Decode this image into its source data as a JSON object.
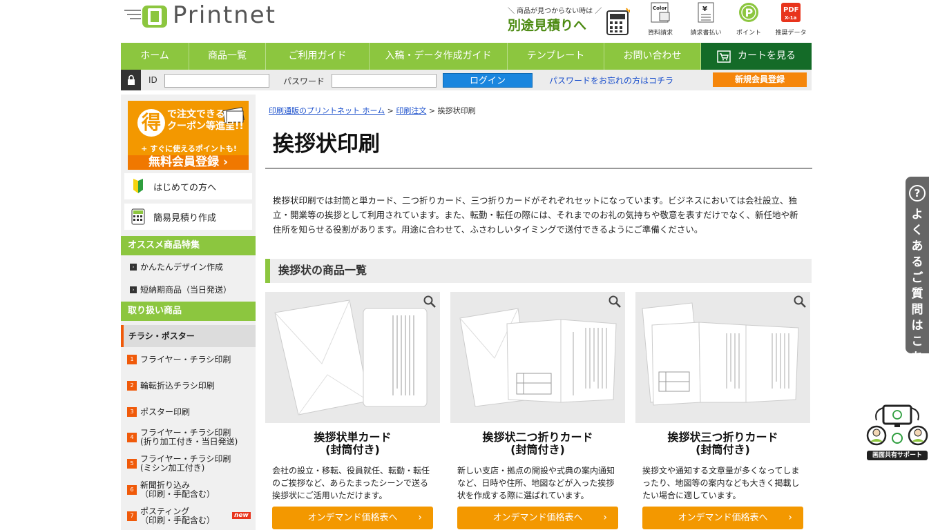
{
  "header": {
    "logo_text": "Printnet",
    "estimate_small": "＼ 商品が見つからない時は ／",
    "estimate_big": "別途見積りへ",
    "icons": [
      {
        "name": "catalog-icon",
        "label": "資料請求",
        "glyph": "Color"
      },
      {
        "name": "invoice-icon",
        "label": "請求書払い",
        "glyph": "¥"
      },
      {
        "name": "point-icon",
        "label": "ポイント",
        "glyph": "P"
      },
      {
        "name": "pdf-icon",
        "label": "推奨データ",
        "glyph": "PDF X-1a"
      }
    ]
  },
  "nav": {
    "items": [
      "ホーム",
      "商品一覧",
      "ご利用ガイド",
      "入稿・データ作成ガイド",
      "テンプレート",
      "お問い合わせ"
    ],
    "cart": "カートを見る"
  },
  "login": {
    "id_label": "ID",
    "password_label": "パスワード",
    "id_value": "",
    "password_value": "",
    "login_button": "ログイン",
    "forgot": "パスワードをお忘れの方はコチラ",
    "register": "新規会員登録"
  },
  "sidebar": {
    "banner": {
      "circle": "得",
      "line1": "で注文できる",
      "line2": "クーポン等進呈!!",
      "line3": "+ すぐに使えるポイントも!",
      "line4": "無料会員登録 ›"
    },
    "beginner": "はじめての方へ",
    "quick_estimate": "簡易見積り作成",
    "featured_header": "オススメ商品特集",
    "featured": [
      "かんたんデザイン作成",
      "短納期商品（当日発送）"
    ],
    "products_header": "取り扱い商品",
    "category": "チラシ・ポスター",
    "items": [
      {
        "num": "1",
        "line1": "フライヤー・チラシ印刷",
        "line2": ""
      },
      {
        "num": "2",
        "line1": "輪転折込チラシ印刷",
        "line2": ""
      },
      {
        "num": "3",
        "line1": "ポスター印刷",
        "line2": ""
      },
      {
        "num": "4",
        "line1": "フライヤー・チラシ印刷",
        "line2": "(折り加工付き・当日発送)"
      },
      {
        "num": "5",
        "line1": "フライヤー・チラシ印刷",
        "line2": "(ミシン加工付き)"
      },
      {
        "num": "6",
        "line1": "新聞折り込み",
        "line2": "（印刷・手配含む）"
      },
      {
        "num": "7",
        "line1": "ポスティング",
        "line2": "（印刷・手配含む）"
      }
    ],
    "new_badge": "new"
  },
  "breadcrumb": {
    "home": "印刷通販のプリントネット ホーム",
    "sep": ">",
    "parent": "印刷注文",
    "current": "挨拶状印刷"
  },
  "page": {
    "title": "挨拶状印刷",
    "intro": "挨拶状印刷では封筒と単カード、二つ折りカード、三つ折りカードがそれぞれセットになっています。ビジネスにおいては会社設立、独立・開業等の挨拶として利用されています。また、転勤・転任の際には、それまでのお礼の気持ちや敬意を表すだけでなく、新任地や新住所を知らせる役割があります。用途に合わせて、ふさわしいタイミングで送付できるようにご準備ください。",
    "section_title": "挨拶状の商品一覧"
  },
  "products": [
    {
      "name1": "挨拶状単カード",
      "name2": "(封筒付き)",
      "desc": "会社の設立・移転、役員就任、転勤・転任のご挨拶など、あらたまったシーンで送る挨拶状にご活用いただけます。",
      "button": "オンデマンド価格表へ"
    },
    {
      "name1": "挨拶状二つ折りカード",
      "name2": "(封筒付き)",
      "desc": "新しい支店・拠点の開設や式典の案内通知など、日時や住所、地図などが入った挨拶状を作成する際に選ばれています。",
      "button": "オンデマンド価格表へ"
    },
    {
      "name1": "挨拶状三つ折りカード",
      "name2": "(封筒付き)",
      "desc": "挨拶文や通知する文章量が多くなってしまったり、地図等の案内なども大きく掲載したい場合に適しています。",
      "button": "オンデマンド価格表へ"
    }
  ],
  "widgets": {
    "faq_q": "?",
    "faq_text": "よくあるご質問はこちら",
    "share_label": "画面共有サポート"
  },
  "colors": {
    "brand_green": "#8cc63f",
    "cart_green": "#146b28",
    "orange": "#f39800",
    "login_blue": "#1a86de",
    "accent_red": "#f05a0a"
  }
}
